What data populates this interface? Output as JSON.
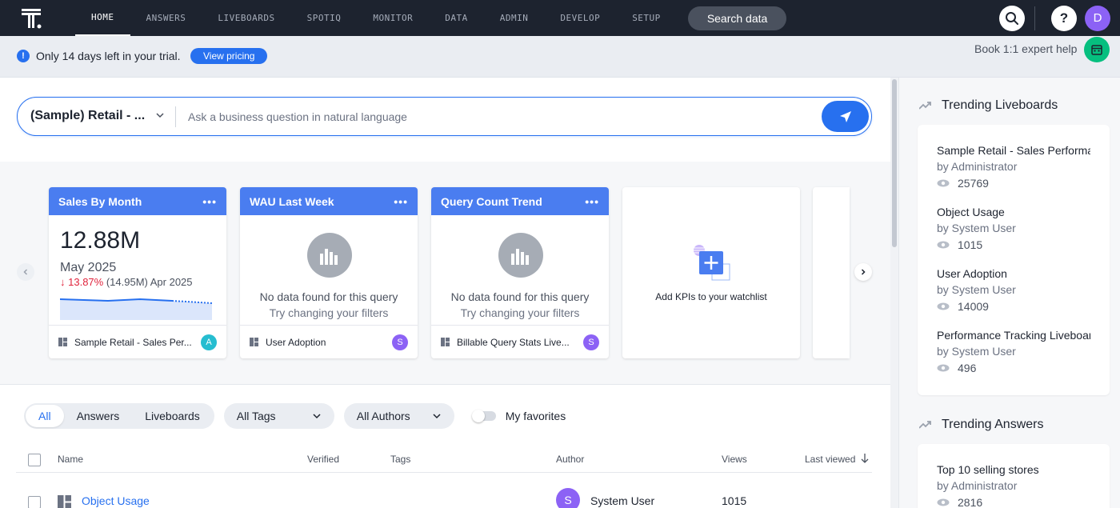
{
  "nav": {
    "items": [
      {
        "label": "HOME",
        "active": true
      },
      {
        "label": "ANSWERS"
      },
      {
        "label": "LIVEBOARDS"
      },
      {
        "label": "SPOTIQ"
      },
      {
        "label": "MONITOR"
      },
      {
        "label": "DATA"
      },
      {
        "label": "ADMIN"
      },
      {
        "label": "DEVELOP"
      },
      {
        "label": "SETUP"
      }
    ],
    "search_label": "Search data",
    "avatar_initial": "D"
  },
  "banner": {
    "message": "Only 14 days left in your trial.",
    "pricing_label": "View pricing",
    "book_label": "Book 1:1 expert help"
  },
  "ask": {
    "source": "(Sample) Retail - ...",
    "placeholder": "Ask a business question in natural language"
  },
  "kpis": [
    {
      "title": "Sales By Month",
      "value": "12.88M",
      "period": "May 2025",
      "change": "13.87%",
      "compare": "(14.95M) Apr 2025",
      "source": "Sample Retail - Sales Per...",
      "author_initial": "A",
      "author_color": "#26bdd0"
    },
    {
      "title": "WAU Last Week",
      "nodata": "No data found for this query",
      "hint": "Try changing your filters",
      "source": "User Adoption",
      "author_initial": "S",
      "author_color": "#8c62f5"
    },
    {
      "title": "Query Count Trend",
      "nodata": "No data found for this query",
      "hint": "Try changing your filters",
      "source": "Billable Query Stats Live...",
      "author_initial": "S",
      "author_color": "#8c62f5"
    }
  ],
  "add_kpi_label": "Add KPIs to your watchlist",
  "filters": {
    "segments": [
      "All",
      "Answers",
      "Liveboards"
    ],
    "tags_label": "All Tags",
    "authors_label": "All Authors",
    "favorites_label": "My favorites"
  },
  "table": {
    "headers": {
      "name": "Name",
      "verified": "Verified",
      "tags": "Tags",
      "author": "Author",
      "views": "Views",
      "last_viewed": "Last viewed"
    },
    "rows": [
      {
        "name": "Object Usage",
        "author": "System User",
        "author_initial": "S",
        "views": "1015"
      }
    ]
  },
  "trending_liveboards": {
    "title": "Trending Liveboards",
    "items": [
      {
        "name": "Sample Retail - Sales Performance",
        "by": "by Administrator",
        "views": "25769"
      },
      {
        "name": "Object Usage",
        "by": "by System User",
        "views": "1015"
      },
      {
        "name": "User Adoption",
        "by": "by System User",
        "views": "14009"
      },
      {
        "name": "Performance Tracking Liveboard",
        "by": "by System User",
        "views": "496"
      }
    ]
  },
  "trending_answers": {
    "title": "Trending Answers",
    "items": [
      {
        "name": "Top 10 selling stores",
        "by": "by Administrator",
        "views": "2816"
      }
    ]
  },
  "colors": {
    "brand_blue": "#2770ef",
    "kpi_header": "#4a7df0",
    "nav_bg": "#1d232f",
    "negative": "#e0233c"
  }
}
